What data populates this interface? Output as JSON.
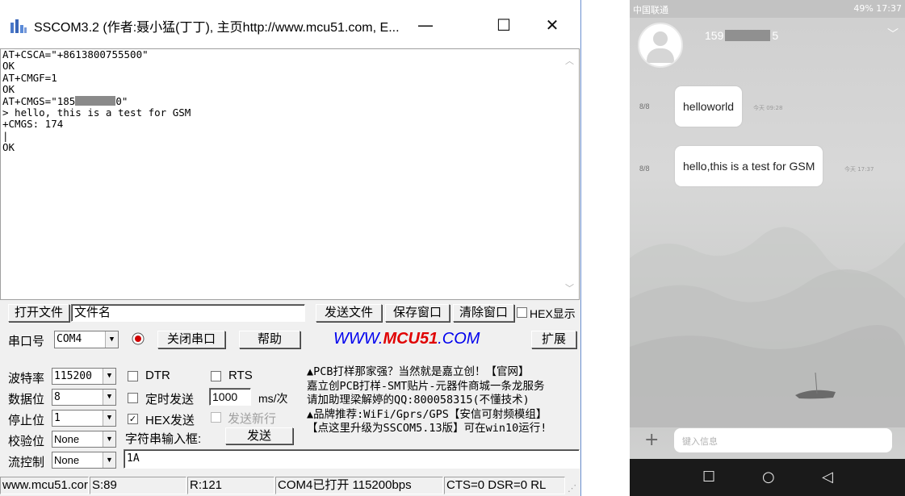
{
  "sscom": {
    "title": "SSCOM3.2 (作者:聂小猛(丁丁), 主页http://www.mcu51.com,  E...",
    "window_buttons": {
      "minimize": "—",
      "maximize": "☐",
      "close": "✕"
    },
    "terminal_lines": [
      "AT+CSCA=\"+8613800755500\"",
      "OK",
      "AT+CMGF=1",
      "OK",
      "AT+CMGS=\"185",
      "0\"",
      "> hello, this is a test for GSM",
      "+CMGS: 174",
      "|",
      "OK"
    ],
    "open_file_button": "打开文件",
    "filename_value": "文件名",
    "send_file_button": "发送文件",
    "save_window_button": "保存窗口",
    "clear_window_button": "清除窗口",
    "hex_display_label": "HEX显示",
    "port_label": "串口号",
    "port_value": "COM4",
    "close_port_button": "关闭串口",
    "help_button": "帮助",
    "web_link_prefix": "WWW.",
    "web_link_brand": "MCU51",
    "web_link_suffix": ".COM",
    "expand_button": "扩展",
    "baud_label": "波特率",
    "baud_value": "115200",
    "databits_label": "数据位",
    "databits_value": "8",
    "stopbits_label": "停止位",
    "stopbits_value": "1",
    "parity_label": "校验位",
    "parity_value": "None",
    "flow_label": "流控制",
    "flow_value": "None",
    "dtr_label": "DTR",
    "rts_label": "RTS",
    "timed_send_label": "定时发送",
    "interval_value": "1000",
    "interval_unit": "ms/次",
    "hex_send_label": "HEX发送",
    "send_newline_label": "发送新行",
    "string_input_label": "字符串输入框:",
    "send_button": "发送",
    "send_value": "1A",
    "ad_lines": [
      "▲PCB打样那家强？当然就是嘉立创！【官网】",
      "嘉立创PCB打样-SMT贴片-元器件商城一条龙服务",
      "请加助理梁解婷的QQ:800058315(不懂技术)",
      "▲品牌推荐:WiFi/Gprs/GPS【安信可射频模组】",
      "【点这里升级为SSCOM5.13版】可在win10运行!"
    ],
    "status_site": "www.mcu51.cor",
    "status_sent": "S:89",
    "status_received": "R:121",
    "status_port": "COM4已打开  115200bps",
    "status_lines": "CTS=0 DSR=0 RL"
  },
  "phone": {
    "carrier": "中国联通",
    "status_right": "49% 17:37",
    "contact_prefix": "159",
    "contact_suffix": "5",
    "messages": [
      {
        "date": "8/8",
        "text": "helloworld",
        "time": "今天 09:28"
      },
      {
        "date": "8/8",
        "text": "hello,this is a test for GSM",
        "time": "今天 17:37"
      }
    ],
    "input_placeholder": "键入信息",
    "nav": {
      "recent": "☐",
      "home": "○",
      "back": "◁"
    }
  }
}
